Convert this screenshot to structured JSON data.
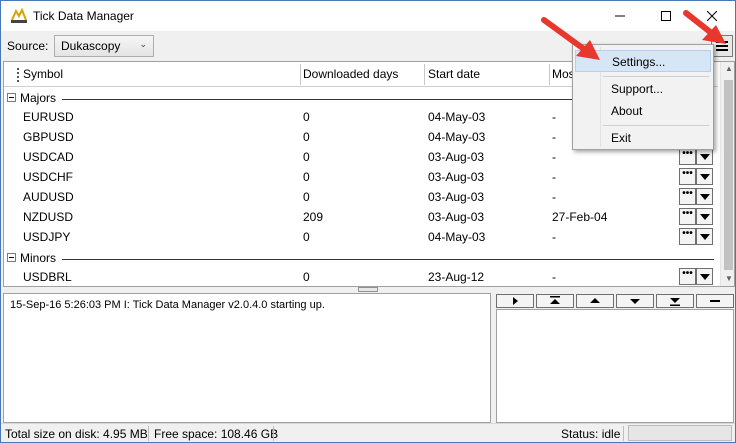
{
  "window": {
    "title": "Tick Data Manager",
    "controls": {
      "minimize": "minimize-icon",
      "maximize": "maximize-icon",
      "close": "close-icon"
    }
  },
  "toolbar": {
    "source_label": "Source:",
    "source_value": "Dukascopy",
    "menu_icon": "hamburger-menu-icon"
  },
  "grid": {
    "columns": [
      "Symbol",
      "Downloaded days",
      "Start date",
      "Mos"
    ],
    "groups": [
      {
        "name": "Majors",
        "rows": [
          {
            "symbol": "EURUSD",
            "days": "0",
            "start": "04-May-03",
            "most": "-"
          },
          {
            "symbol": "GBPUSD",
            "days": "0",
            "start": "04-May-03",
            "most": "-"
          },
          {
            "symbol": "USDCAD",
            "days": "0",
            "start": "03-Aug-03",
            "most": "-"
          },
          {
            "symbol": "USDCHF",
            "days": "0",
            "start": "03-Aug-03",
            "most": "-"
          },
          {
            "symbol": "AUDUSD",
            "days": "0",
            "start": "03-Aug-03",
            "most": "-"
          },
          {
            "symbol": "NZDUSD",
            "days": "209",
            "start": "03-Aug-03",
            "most": "27-Feb-04"
          },
          {
            "symbol": "USDJPY",
            "days": "0",
            "start": "04-May-03",
            "most": "-"
          }
        ]
      },
      {
        "name": "Minors",
        "rows": [
          {
            "symbol": "USDBRL",
            "days": "0",
            "start": "23-Aug-12",
            "most": "-"
          }
        ]
      }
    ],
    "row_button_label": "•••"
  },
  "log": {
    "lines": [
      "15-Sep-16 5:26:03 PM  I: Tick Data Manager v2.0.4.0 starting up."
    ]
  },
  "queue_controls": [
    "play-icon",
    "move-top-icon",
    "move-up-icon",
    "move-down-icon",
    "move-bottom-icon",
    "remove-icon"
  ],
  "statusbar": {
    "total_size": "Total size on disk: 4.95 MB",
    "free_space": "Free space: 108.46 GB",
    "status": "Status: idle"
  },
  "menu": {
    "items": [
      "Settings...",
      "Support...",
      "About",
      "Exit"
    ]
  },
  "colors": {
    "annotation_red": "#e8372c",
    "menu_highlight": "#d7e6f7"
  }
}
